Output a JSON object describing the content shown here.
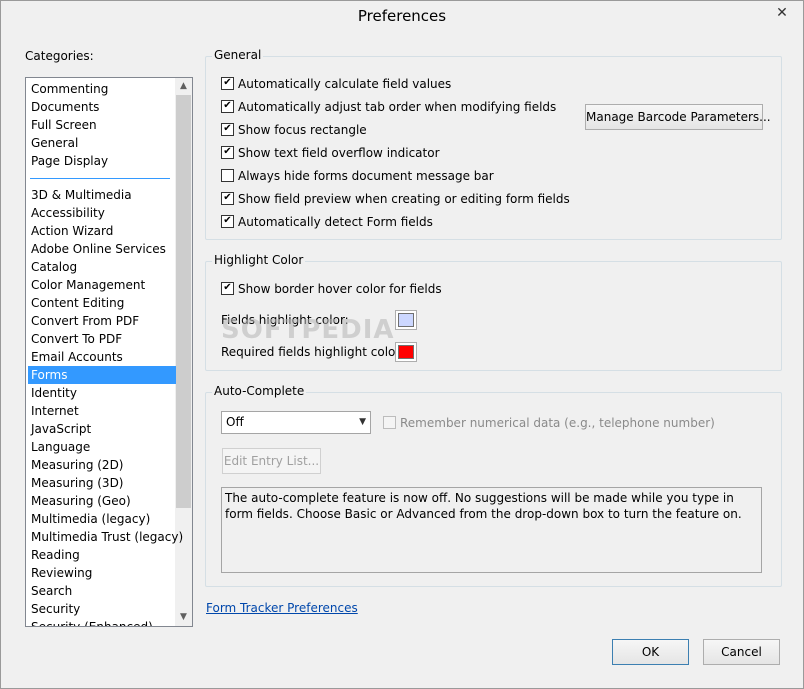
{
  "window": {
    "title": "Preferences",
    "close_glyph": "✕"
  },
  "categories": {
    "label": "Categories:",
    "top_items": [
      "Commenting",
      "Documents",
      "Full Screen",
      "General",
      "Page Display"
    ],
    "items": [
      "3D & Multimedia",
      "Accessibility",
      "Action Wizard",
      "Adobe Online Services",
      "Catalog",
      "Color Management",
      "Content Editing",
      "Convert From PDF",
      "Convert To PDF",
      "Email Accounts",
      "Forms",
      "Identity",
      "Internet",
      "JavaScript",
      "Language",
      "Measuring (2D)",
      "Measuring (3D)",
      "Measuring (Geo)",
      "Multimedia (legacy)",
      "Multimedia Trust (legacy)",
      "Reading",
      "Reviewing",
      "Search",
      "Security",
      "Security (Enhanced)"
    ],
    "selected": "Forms"
  },
  "general": {
    "legend": "General",
    "checkboxes": [
      {
        "label": "Automatically calculate field values",
        "checked": true
      },
      {
        "label": "Automatically adjust tab order when modifying fields",
        "checked": true
      },
      {
        "label": "Show focus rectangle",
        "checked": true
      },
      {
        "label": "Show text field overflow indicator",
        "checked": true
      },
      {
        "label": "Always hide forms document message bar",
        "checked": false
      },
      {
        "label": "Show field preview when creating or editing form fields",
        "checked": true
      },
      {
        "label": "Automatically detect Form fields",
        "checked": true
      }
    ],
    "barcode_button": "Manage Barcode Parameters..."
  },
  "highlight": {
    "legend": "Highlight Color",
    "hover_checkbox": {
      "label": "Show border hover color for fields",
      "checked": true
    },
    "fields_label": "Fields highlight color:",
    "fields_color": "#ccd7ff",
    "required_label": "Required fields highlight color:",
    "required_color": "#ff0000"
  },
  "autocomplete": {
    "legend": "Auto-Complete",
    "select_value": "Off",
    "remember_checkbox": {
      "label": "Remember numerical data (e.g., telephone number)",
      "checked": false
    },
    "edit_button": "Edit Entry List...",
    "info_text": "The auto-complete feature is now off. No suggestions will be made while you type in form fields. Choose Basic or Advanced from the drop-down box to turn the feature on."
  },
  "link": "Form Tracker Preferences",
  "buttons": {
    "ok": "OK",
    "cancel": "Cancel"
  },
  "watermark": "SOFTPEDIA"
}
